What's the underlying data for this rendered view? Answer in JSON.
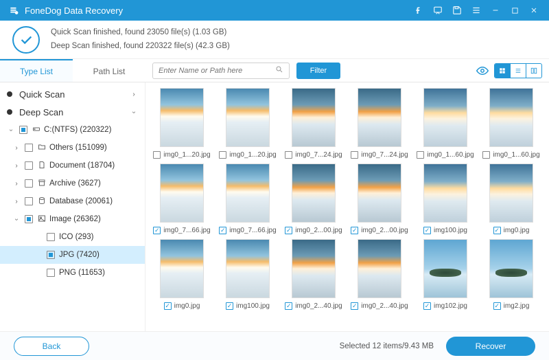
{
  "app": {
    "title": "FoneDog Data Recovery"
  },
  "status": {
    "line1": "Quick Scan finished, found 23050 file(s) (1.03 GB)",
    "line2": "Deep Scan finished, found 220322 file(s) (42.3 GB)"
  },
  "tabs": {
    "type_list": "Type List",
    "path_list": "Path List"
  },
  "toolbar": {
    "search_placeholder": "Enter Name or Path here",
    "filter": "Filter"
  },
  "sidebar": {
    "quick_scan": "Quick Scan",
    "deep_scan": "Deep Scan",
    "drive": "C:(NTFS) (220322)",
    "others": "Others (151099)",
    "document": "Document (18704)",
    "archive": "Archive (3627)",
    "database": "Database (20061)",
    "image": "Image (26362)",
    "ico": "ICO (293)",
    "jpg": "JPG (7420)",
    "png": "PNG (11653)"
  },
  "files": [
    {
      "name": "img0_1...20.jpg",
      "sel": false,
      "t": "t1"
    },
    {
      "name": "img0_1...20.jpg",
      "sel": false,
      "t": "t1"
    },
    {
      "name": "img0_7...24.jpg",
      "sel": false,
      "t": "t2"
    },
    {
      "name": "img0_7...24.jpg",
      "sel": false,
      "t": "t2"
    },
    {
      "name": "img0_1...60.jpg",
      "sel": false,
      "t": "t3"
    },
    {
      "name": "img0_1...60.jpg",
      "sel": false,
      "t": "t3"
    },
    {
      "name": "img0_7...66.jpg",
      "sel": true,
      "t": "t1"
    },
    {
      "name": "img0_7...66.jpg",
      "sel": true,
      "t": "t1"
    },
    {
      "name": "img0_2...00.jpg",
      "sel": true,
      "t": "t2"
    },
    {
      "name": "img0_2...00.jpg",
      "sel": true,
      "t": "t2"
    },
    {
      "name": "img100.jpg",
      "sel": true,
      "t": "t3"
    },
    {
      "name": "img0.jpg",
      "sel": true,
      "t": "t3"
    },
    {
      "name": "img0.jpg",
      "sel": true,
      "t": "t1"
    },
    {
      "name": "img100.jpg",
      "sel": true,
      "t": "t1"
    },
    {
      "name": "img0_2...40.jpg",
      "sel": true,
      "t": "t2"
    },
    {
      "name": "img0_2...40.jpg",
      "sel": true,
      "t": "t2"
    },
    {
      "name": "img102.jpg",
      "sel": true,
      "t": "island"
    },
    {
      "name": "img2.jpg",
      "sel": true,
      "t": "island"
    }
  ],
  "footer": {
    "back": "Back",
    "selected": "Selected 12 items/9.43 MB",
    "recover": "Recover"
  }
}
